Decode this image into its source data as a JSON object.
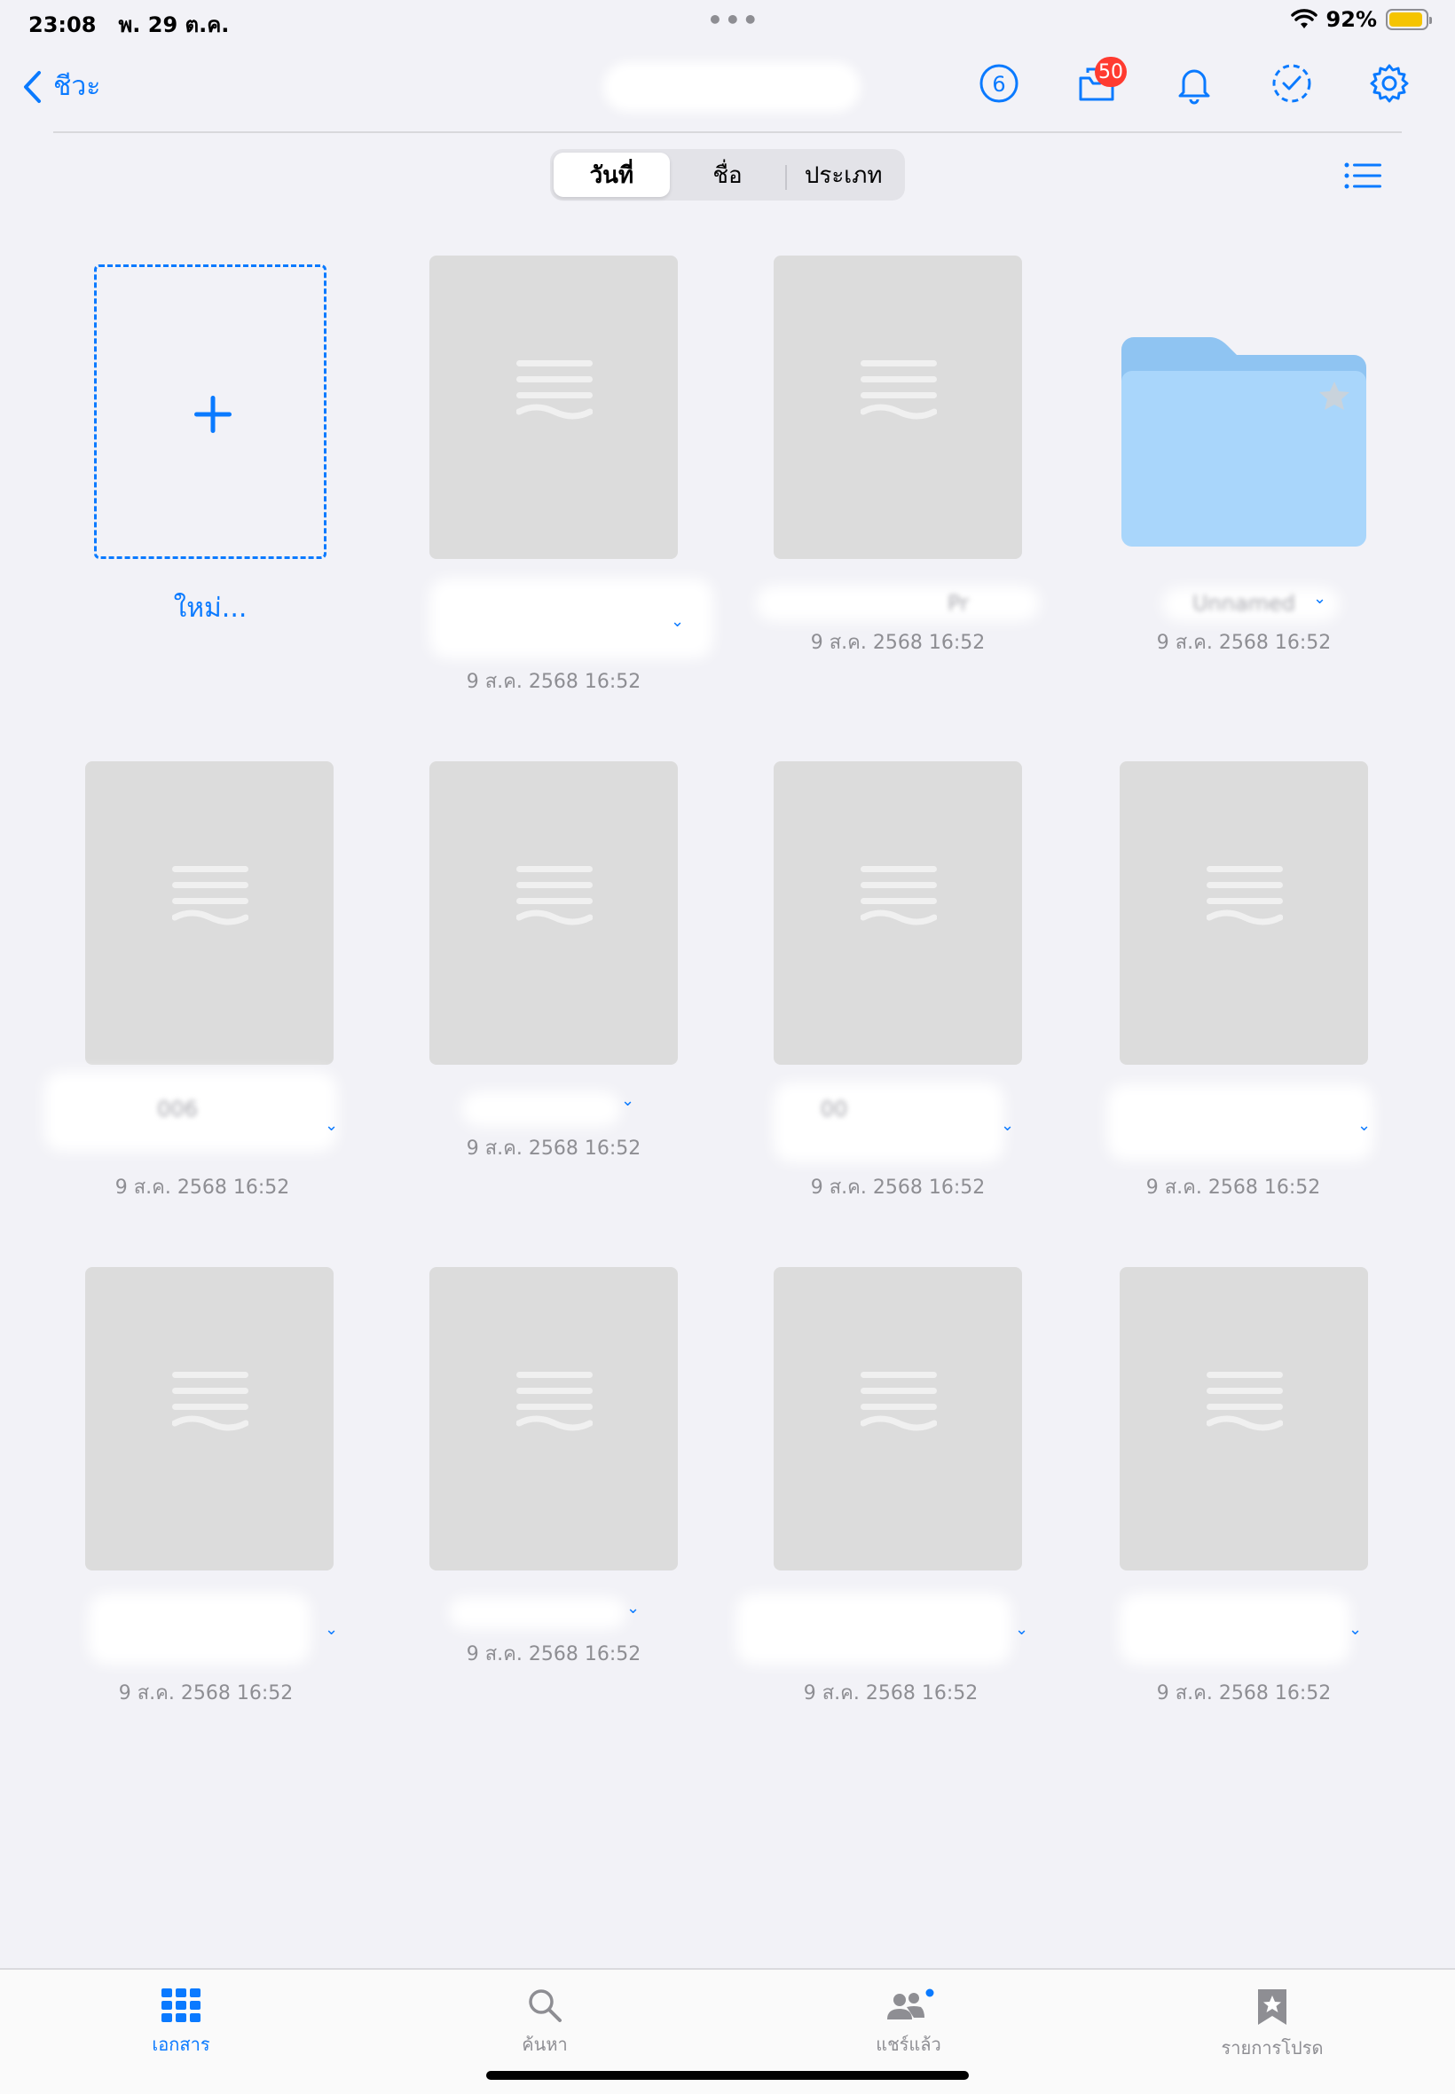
{
  "status_bar": {
    "time": "23:08",
    "date": "พ. 29 ต.ค.",
    "dots": "•••",
    "battery_percent": "92%",
    "battery_level": 0.92,
    "battery_color": "#f5c400"
  },
  "nav": {
    "back_label": "ชีวะ",
    "share_count": "6",
    "inbox_badge": "50",
    "accent_color": "#0a7aff",
    "icons": [
      "chevron-left-icon",
      "person-circle-icon",
      "tray-icon",
      "bell-icon",
      "dashed-checkmark-circle-icon",
      "gear-icon"
    ]
  },
  "sort": {
    "segments": [
      "วันที่",
      "ชื่อ",
      "ประเภท"
    ],
    "selected": "วันที่"
  },
  "grid": {
    "new_label": "ใหม่...",
    "items": [
      {
        "type": "document",
        "date": "9 ส.ค. 2568 16:52"
      },
      {
        "type": "document",
        "name": "Pr",
        "date": "9 ส.ค. 2568 16:52"
      },
      {
        "type": "folder",
        "name": "Unnamed",
        "date": "9 ส.ค. 2568 16:52"
      },
      {
        "type": "document",
        "name": "006",
        "date": "9 ส.ค. 2568 16:52"
      },
      {
        "type": "document",
        "date": "9 ส.ค. 2568 16:52"
      },
      {
        "type": "document",
        "name": "00",
        "date": "9 ส.ค. 2568 16:52"
      },
      {
        "type": "document",
        "date": "9 ส.ค. 2568 16:52"
      },
      {
        "type": "document",
        "date": "9 ส.ค. 2568 16:52"
      },
      {
        "type": "document",
        "date": "9 ส.ค. 2568 16:52"
      },
      {
        "type": "document",
        "date": "9 ส.ค. 2568 16:52"
      },
      {
        "type": "document",
        "date": "9 ส.ค. 2568 16:52"
      }
    ]
  },
  "tabs": [
    {
      "label": "เอกสาร",
      "icon": "grid-icon",
      "active": true
    },
    {
      "label": "ค้นหา",
      "icon": "magnifier-icon",
      "active": false
    },
    {
      "label": "แชร์แล้ว",
      "icon": "people-icon",
      "active": false
    },
    {
      "label": "รายการโปรด",
      "icon": "bookmark-star-icon",
      "active": false
    }
  ]
}
